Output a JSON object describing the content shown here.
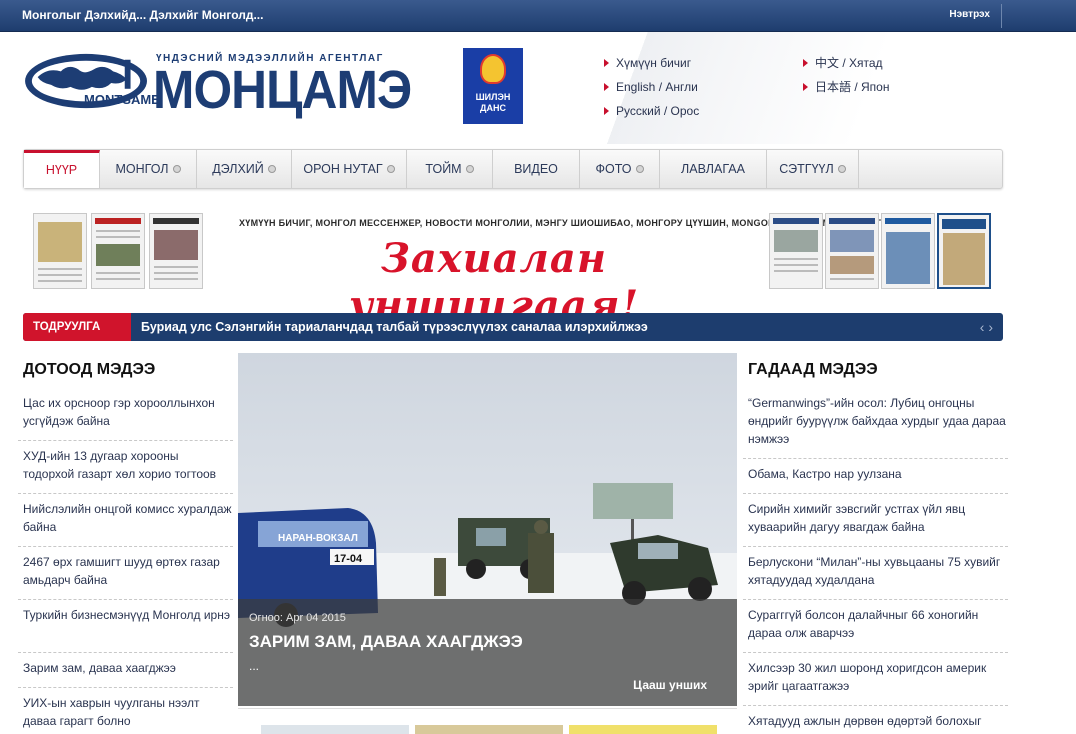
{
  "topbar": {
    "slogan": "Монголыг Дэлхийд... Дэлхийг Монголд...",
    "login": "Нэвтрэх"
  },
  "logo": {
    "agency": "ҮНДЭСНИЙ МЭДЭЭЛЛИЙН АГЕНТЛАГ",
    "name": "МОНЦАМЭ",
    "name_latin": "MONTSAME"
  },
  "seal": {
    "line1": "ШИЛЭН",
    "line2": "ДАНС"
  },
  "languages": {
    "left": [
      "Хүмүүн бичиг",
      "English / Англи",
      "Русский / Орос"
    ],
    "right": [
      "中文 / Хятад",
      "日本語 / Япон"
    ]
  },
  "nav": [
    {
      "label": "НҮҮР",
      "dropdown": false
    },
    {
      "label": "МОНГОЛ",
      "dropdown": true
    },
    {
      "label": "ДЭЛХИЙ",
      "dropdown": true
    },
    {
      "label": "ОРОН НУТАГ",
      "dropdown": true
    },
    {
      "label": "ТОЙМ",
      "dropdown": true
    },
    {
      "label": "ВИДЕО",
      "dropdown": false
    },
    {
      "label": "ФОТО",
      "dropdown": true
    },
    {
      "label": "ЛАВЛАГАА",
      "dropdown": false
    },
    {
      "label": "СЭТГҮҮЛ",
      "dropdown": true
    }
  ],
  "banner": {
    "publications": "ХҮМҮҮН БИЧИГ, МОНГОЛ МЕССЕНЖЕР, НОВОСТИ МОНГОЛИИ, МЭНГУ ШИОШИБАО, МОНГОРУ ЦҮҮШИН, MONGOLIA TODAY, МОНЦАМЭ ТОЙМ",
    "slogan": "Захиалан уншицгаая!"
  },
  "ticker": {
    "label": "ТОДРУУЛГА",
    "text": "Буриад улс Сэлэнгийн тариаланчдад талбай түрээслүүлэх саналаа илэрхийлжээ"
  },
  "domestic": {
    "title": "ДОТООД МЭДЭЭ",
    "items": [
      "Цас их орсноор гэр хорооллынхон усгүйдэж байна",
      "ХУД-ийн 13 дугаар хорооны тодорхой газарт хөл хорио тогтоов",
      "Нийслэлийн онцгой комисс хуралдаж байна",
      "2467 өрх гамшигт шууд өртөх газар амьдарч байна",
      "Туркийн бизнесмэнүүд Монголд ирнэ",
      "Зарим зам, даваа хаагджээ",
      "УИХ-ын хаврын чуулганы нээлт даваа гарагт болно"
    ]
  },
  "foreign": {
    "title": "ГАДААД МЭДЭЭ",
    "items": [
      "“Germanwings”-ийн осол: Лубиц онгоцны өндрийг буурүүлж байхдаа хурдыг удаа дараа нэмжээ",
      "Обама, Кастро нар уулзана",
      "Сирийн химийг зэвсгийг устгах үйл явц хуваарийн дагуу явагдаж байна",
      "Берлускони “Милан”-ны хувьцааны 75 хувийг хятадуудад худалдана",
      "Сурагггүй болсон далайчныг 66 хоногийн дараа олж аварчээ",
      "Хилсээр 30 жил шоронд хоригдсон америк эрийг цагаатгажээ",
      "Хятадууд ажлын дөрвөн өдөртэй болохыг"
    ]
  },
  "feature": {
    "date": "Огноо: Apr 04 2015",
    "title": "ЗАРИМ ЗАМ, ДАВАА ХААГДЖЭЭ",
    "excerpt": "...",
    "more": "Цааш унших",
    "bus_route": "НАРАН-ВОКЗАЛ",
    "bus_number": "17-04"
  },
  "colors": {
    "brand_blue": "#1d3d74",
    "accent_red": "#c8102e",
    "ticker_bg": "#1d3d6e"
  }
}
